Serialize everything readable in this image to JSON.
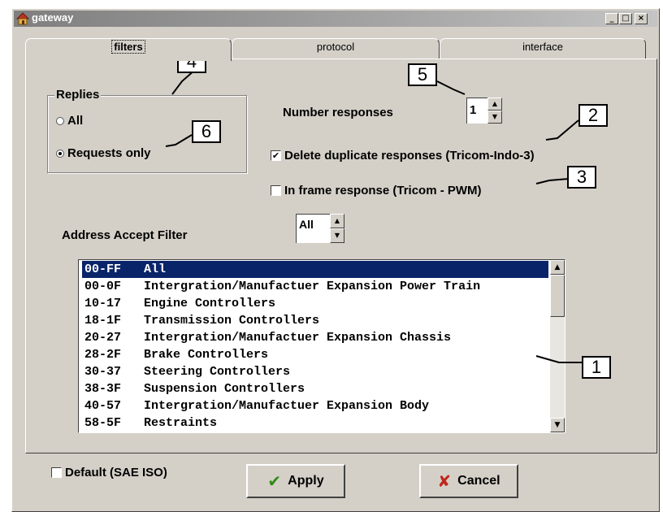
{
  "window": {
    "title": "gateway",
    "minimize_label": "_",
    "maximize_label": "□",
    "close_label": "×"
  },
  "tabs": [
    {
      "label": "filters",
      "active": true
    },
    {
      "label": "protocol",
      "active": false
    },
    {
      "label": "interface",
      "active": false
    }
  ],
  "replies": {
    "group_title": "Replies",
    "options": [
      {
        "label": "All",
        "checked": false
      },
      {
        "label": "Requests only",
        "checked": true
      }
    ]
  },
  "number_responses": {
    "label": "Number responses",
    "value": "1"
  },
  "delete_duplicates": {
    "label": "Delete duplicate responses (Tricom-Indo-3)",
    "checked": true
  },
  "in_frame_response": {
    "label": "In frame response (Tricom - PWM)",
    "checked": false
  },
  "address_filter": {
    "label": "Address Accept Filter",
    "value": "All"
  },
  "address_list": [
    {
      "code": "00-FF",
      "name": "All",
      "selected": true
    },
    {
      "code": "00-0F",
      "name": "Intergration/Manufactuer Expansion Power Train",
      "selected": false
    },
    {
      "code": "10-17",
      "name": "Engine Controllers",
      "selected": false
    },
    {
      "code": "18-1F",
      "name": "Transmission Controllers",
      "selected": false
    },
    {
      "code": "20-27",
      "name": "Intergration/Manufactuer Expansion Chassis",
      "selected": false
    },
    {
      "code": "28-2F",
      "name": "Brake Controllers",
      "selected": false
    },
    {
      "code": "30-37",
      "name": "Steering Controllers",
      "selected": false
    },
    {
      "code": "38-3F",
      "name": "Suspension Controllers",
      "selected": false
    },
    {
      "code": "40-57",
      "name": "Intergration/Manufactuer Expansion Body",
      "selected": false
    },
    {
      "code": "58-5F",
      "name": "Restraints",
      "selected": false
    }
  ],
  "default_sae_iso": {
    "label": "Default (SAE ISO)",
    "checked": false
  },
  "buttons": {
    "apply_label": "Apply",
    "cancel_label": "Cancel"
  },
  "callouts": [
    "1",
    "2",
    "3",
    "4",
    "5",
    "6"
  ],
  "colors": {
    "selection": "#0a246a",
    "apply_icon": "#2e8b16",
    "cancel_icon": "#c0281c"
  }
}
